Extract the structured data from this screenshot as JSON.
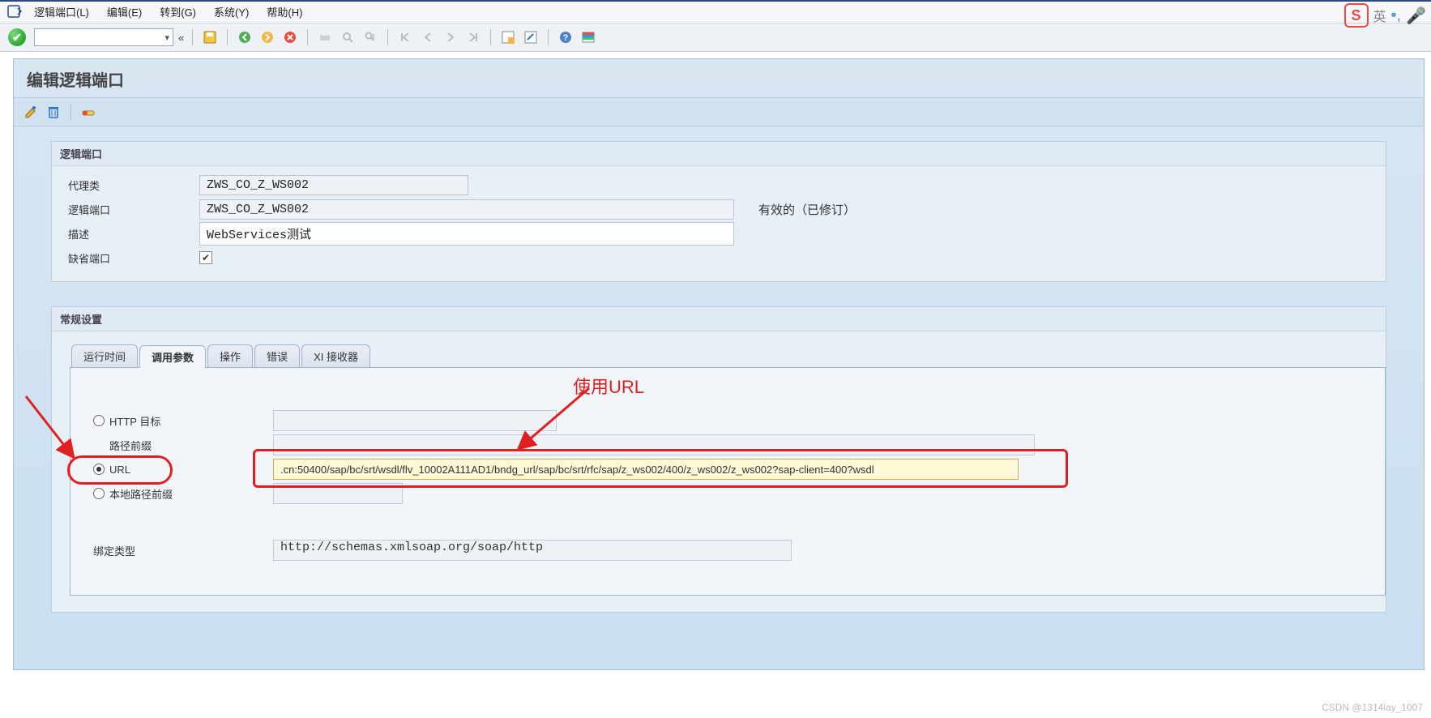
{
  "menu": {
    "items": [
      "逻辑端口(L)",
      "编辑(E)",
      "转到(G)",
      "系统(Y)",
      "帮助(H)"
    ]
  },
  "ime": {
    "logo": "S",
    "text": "英",
    "dots": "•,",
    "mic": "🎤"
  },
  "toolbar": {
    "chevrons": "«"
  },
  "page": {
    "title": "编辑逻辑端口",
    "icons": {
      "edit": "edit",
      "trash": "trash",
      "toggle": "toggle"
    }
  },
  "group1": {
    "title": "逻辑端口",
    "rows": {
      "proxy_class_label": "代理类",
      "proxy_class_value": "ZWS_CO_Z_WS002",
      "logical_port_label": "逻辑端口",
      "logical_port_value": "ZWS_CO_Z_WS002",
      "logical_port_status": "有效的（已修订）",
      "desc_label": "描述",
      "desc_value": "WebServices测试",
      "default_port_label": "缺省端口",
      "default_port_checked": "✔"
    }
  },
  "group2": {
    "title": "常规设置",
    "tabs": [
      "运行时间",
      "调用参数",
      "操作",
      "错误",
      "XI 接收器"
    ],
    "active_tab": 1,
    "radios": {
      "http_target": "HTTP 目标",
      "path_prefix": "路径前缀",
      "url": "URL",
      "local_prefix": "本地路径前缀"
    },
    "url_value": ".cn:50400/sap/bc/srt/wsdl/flv_10002A111AD1/bndg_url/sap/bc/srt/rfc/sap/z_ws002/400/z_ws002/z_ws002?sap-client=400?wsdl",
    "bind_type_label": "绑定类型",
    "bind_type_value": "http://schemas.xmlsoap.org/soap/http"
  },
  "annotation": {
    "use_url": "使用URL"
  },
  "watermark": "CSDN @1314lay_1007"
}
